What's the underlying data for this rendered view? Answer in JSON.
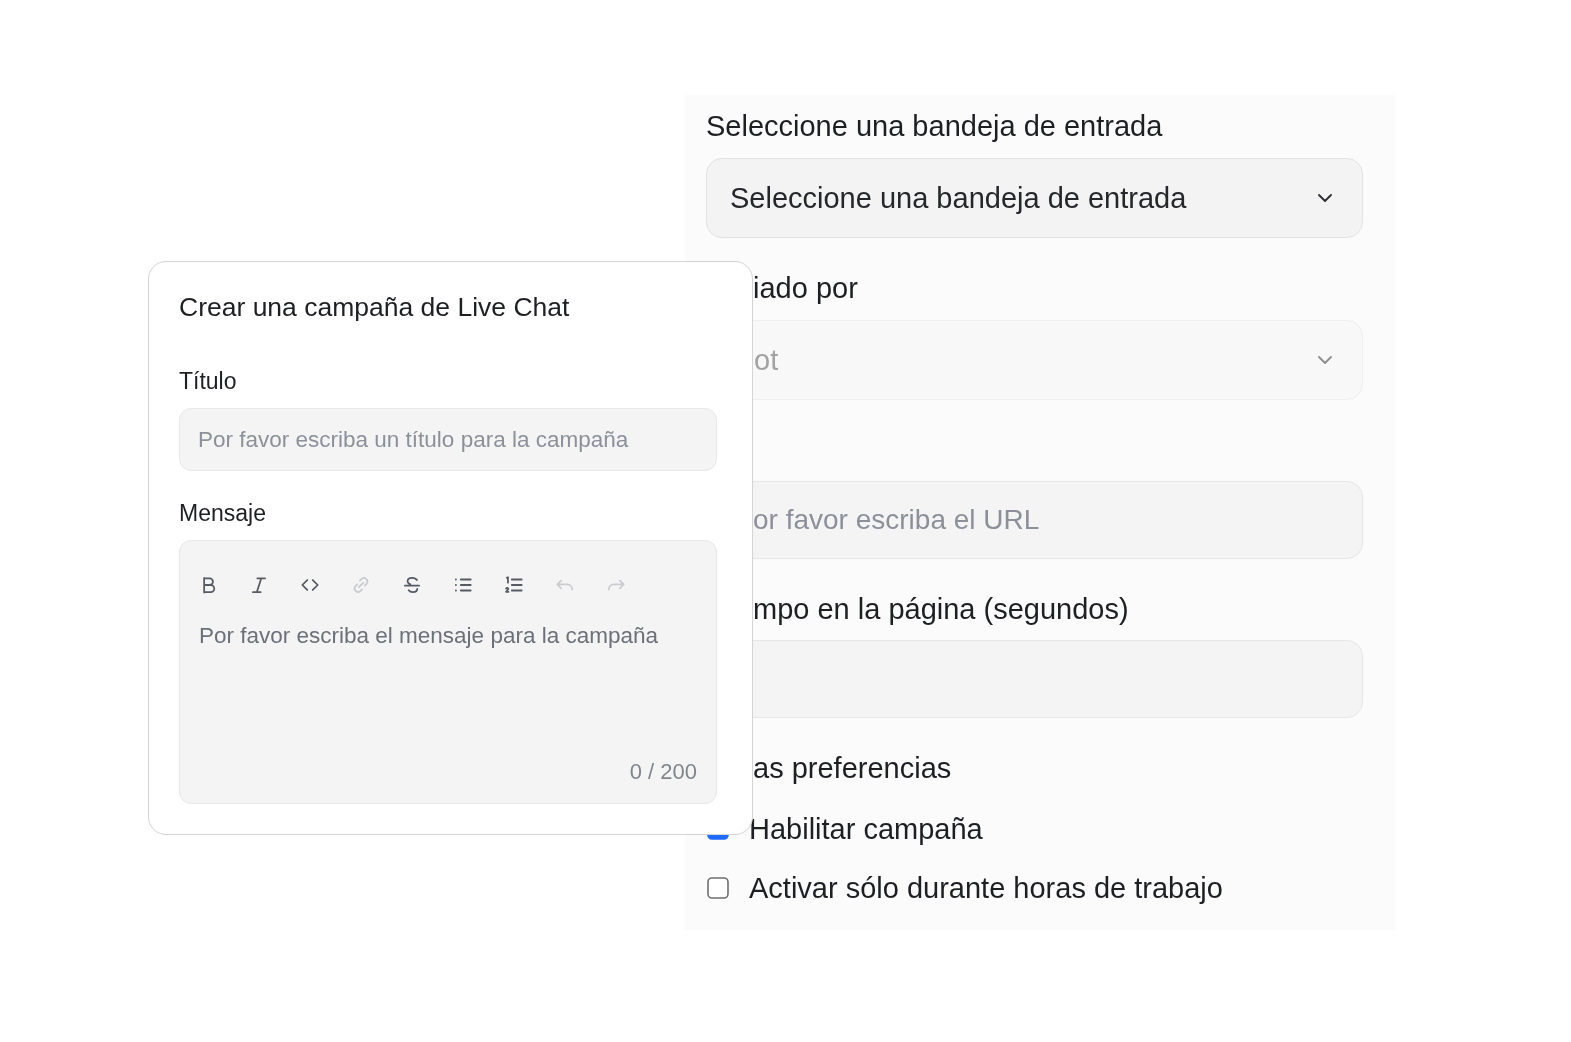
{
  "form": {
    "fields": [
      {
        "kind": "select",
        "label": "Seleccione una bandeja de entrada",
        "value": "Seleccione una bandeja de entrada",
        "disabled": false
      },
      {
        "kind": "select",
        "label": "iado por",
        "value": "ot",
        "disabled": true
      },
      {
        "kind": "text",
        "placeholder": "or favor escriba el URL"
      },
      {
        "kind": "text",
        "label": "mpo en la página (segundos)"
      }
    ],
    "preferences": {
      "label": "as preferencias",
      "options": [
        {
          "label": "Habilitar campaña",
          "checked": true
        },
        {
          "label": "Activar sólo durante horas de trabajo",
          "checked": false
        }
      ]
    }
  },
  "dialog": {
    "title": "Crear una campaña de Live Chat",
    "title_field": {
      "label": "Título",
      "placeholder": "Por favor escriba un título para la campaña"
    },
    "message_field": {
      "label": "Mensaje",
      "toolbar": [
        {
          "kind": "bold",
          "disabled": false
        },
        {
          "kind": "italic",
          "disabled": false
        },
        {
          "kind": "code",
          "disabled": false
        },
        {
          "kind": "link",
          "disabled": true
        },
        {
          "kind": "strike",
          "disabled": false
        },
        {
          "kind": "bullets",
          "disabled": false
        },
        {
          "kind": "numbers",
          "disabled": false
        },
        {
          "kind": "undo",
          "disabled": true
        },
        {
          "kind": "redo",
          "disabled": true
        }
      ],
      "placeholder": "Por favor escriba el mensaje para la campaña",
      "counter": "0 / 200"
    }
  }
}
